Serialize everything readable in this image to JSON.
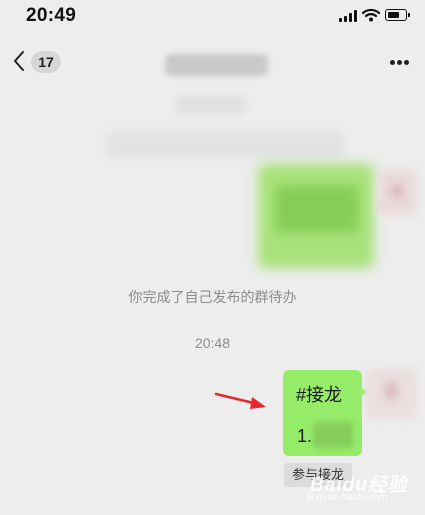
{
  "status_bar": {
    "time": "20:49"
  },
  "nav": {
    "unread_count": "17",
    "icons": {
      "back": "chevron-left-icon",
      "more": "more-dots-icon"
    }
  },
  "chat": {
    "system_notice": "你完成了自己发布的群待办",
    "timestamp": "20:48",
    "solitaire_message": {
      "title": "#接龙",
      "item_number": "1."
    },
    "join_button_label": "参与接龙"
  },
  "watermark": {
    "text": "Baidu经验",
    "subtext": "jingyan.baidu.com"
  },
  "colors": {
    "background": "#ededed",
    "bubble_green": "#95ec69",
    "arrow_red": "#e8262d"
  }
}
